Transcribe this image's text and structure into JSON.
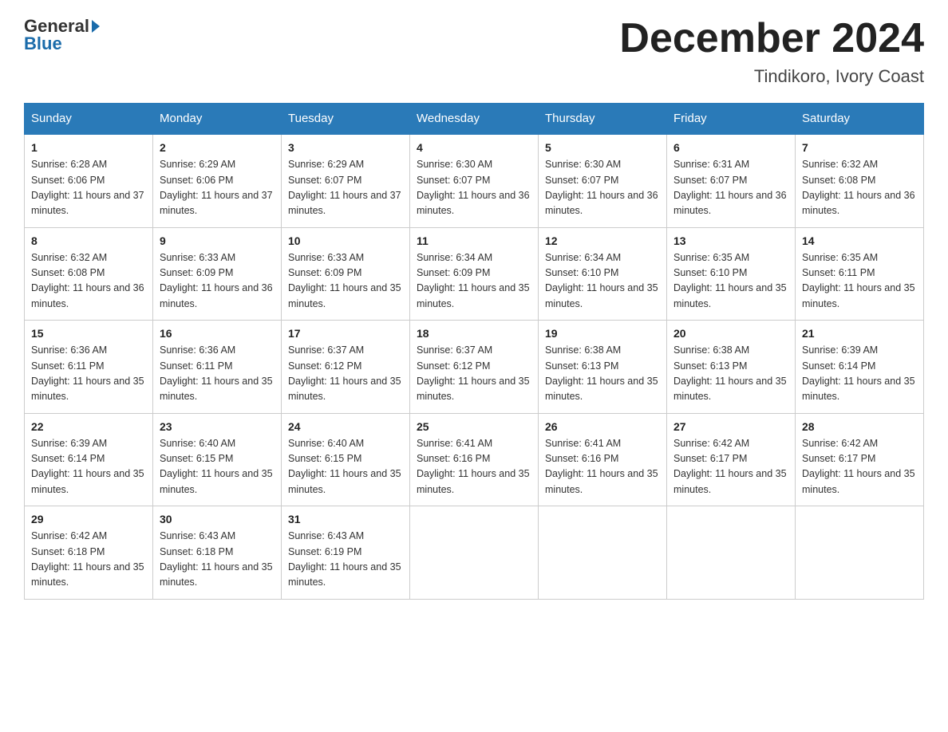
{
  "header": {
    "logo": {
      "text1": "General",
      "text2": "Blue"
    },
    "title": "December 2024",
    "location": "Tindikoro, Ivory Coast"
  },
  "days_of_week": [
    "Sunday",
    "Monday",
    "Tuesday",
    "Wednesday",
    "Thursday",
    "Friday",
    "Saturday"
  ],
  "weeks": [
    [
      {
        "day": "1",
        "sunrise": "6:28 AM",
        "sunset": "6:06 PM",
        "daylight": "11 hours and 37 minutes."
      },
      {
        "day": "2",
        "sunrise": "6:29 AM",
        "sunset": "6:06 PM",
        "daylight": "11 hours and 37 minutes."
      },
      {
        "day": "3",
        "sunrise": "6:29 AM",
        "sunset": "6:07 PM",
        "daylight": "11 hours and 37 minutes."
      },
      {
        "day": "4",
        "sunrise": "6:30 AM",
        "sunset": "6:07 PM",
        "daylight": "11 hours and 36 minutes."
      },
      {
        "day": "5",
        "sunrise": "6:30 AM",
        "sunset": "6:07 PM",
        "daylight": "11 hours and 36 minutes."
      },
      {
        "day": "6",
        "sunrise": "6:31 AM",
        "sunset": "6:07 PM",
        "daylight": "11 hours and 36 minutes."
      },
      {
        "day": "7",
        "sunrise": "6:32 AM",
        "sunset": "6:08 PM",
        "daylight": "11 hours and 36 minutes."
      }
    ],
    [
      {
        "day": "8",
        "sunrise": "6:32 AM",
        "sunset": "6:08 PM",
        "daylight": "11 hours and 36 minutes."
      },
      {
        "day": "9",
        "sunrise": "6:33 AM",
        "sunset": "6:09 PM",
        "daylight": "11 hours and 36 minutes."
      },
      {
        "day": "10",
        "sunrise": "6:33 AM",
        "sunset": "6:09 PM",
        "daylight": "11 hours and 35 minutes."
      },
      {
        "day": "11",
        "sunrise": "6:34 AM",
        "sunset": "6:09 PM",
        "daylight": "11 hours and 35 minutes."
      },
      {
        "day": "12",
        "sunrise": "6:34 AM",
        "sunset": "6:10 PM",
        "daylight": "11 hours and 35 minutes."
      },
      {
        "day": "13",
        "sunrise": "6:35 AM",
        "sunset": "6:10 PM",
        "daylight": "11 hours and 35 minutes."
      },
      {
        "day": "14",
        "sunrise": "6:35 AM",
        "sunset": "6:11 PM",
        "daylight": "11 hours and 35 minutes."
      }
    ],
    [
      {
        "day": "15",
        "sunrise": "6:36 AM",
        "sunset": "6:11 PM",
        "daylight": "11 hours and 35 minutes."
      },
      {
        "day": "16",
        "sunrise": "6:36 AM",
        "sunset": "6:11 PM",
        "daylight": "11 hours and 35 minutes."
      },
      {
        "day": "17",
        "sunrise": "6:37 AM",
        "sunset": "6:12 PM",
        "daylight": "11 hours and 35 minutes."
      },
      {
        "day": "18",
        "sunrise": "6:37 AM",
        "sunset": "6:12 PM",
        "daylight": "11 hours and 35 minutes."
      },
      {
        "day": "19",
        "sunrise": "6:38 AM",
        "sunset": "6:13 PM",
        "daylight": "11 hours and 35 minutes."
      },
      {
        "day": "20",
        "sunrise": "6:38 AM",
        "sunset": "6:13 PM",
        "daylight": "11 hours and 35 minutes."
      },
      {
        "day": "21",
        "sunrise": "6:39 AM",
        "sunset": "6:14 PM",
        "daylight": "11 hours and 35 minutes."
      }
    ],
    [
      {
        "day": "22",
        "sunrise": "6:39 AM",
        "sunset": "6:14 PM",
        "daylight": "11 hours and 35 minutes."
      },
      {
        "day": "23",
        "sunrise": "6:40 AM",
        "sunset": "6:15 PM",
        "daylight": "11 hours and 35 minutes."
      },
      {
        "day": "24",
        "sunrise": "6:40 AM",
        "sunset": "6:15 PM",
        "daylight": "11 hours and 35 minutes."
      },
      {
        "day": "25",
        "sunrise": "6:41 AM",
        "sunset": "6:16 PM",
        "daylight": "11 hours and 35 minutes."
      },
      {
        "day": "26",
        "sunrise": "6:41 AM",
        "sunset": "6:16 PM",
        "daylight": "11 hours and 35 minutes."
      },
      {
        "day": "27",
        "sunrise": "6:42 AM",
        "sunset": "6:17 PM",
        "daylight": "11 hours and 35 minutes."
      },
      {
        "day": "28",
        "sunrise": "6:42 AM",
        "sunset": "6:17 PM",
        "daylight": "11 hours and 35 minutes."
      }
    ],
    [
      {
        "day": "29",
        "sunrise": "6:42 AM",
        "sunset": "6:18 PM",
        "daylight": "11 hours and 35 minutes."
      },
      {
        "day": "30",
        "sunrise": "6:43 AM",
        "sunset": "6:18 PM",
        "daylight": "11 hours and 35 minutes."
      },
      {
        "day": "31",
        "sunrise": "6:43 AM",
        "sunset": "6:19 PM",
        "daylight": "11 hours and 35 minutes."
      },
      null,
      null,
      null,
      null
    ]
  ]
}
